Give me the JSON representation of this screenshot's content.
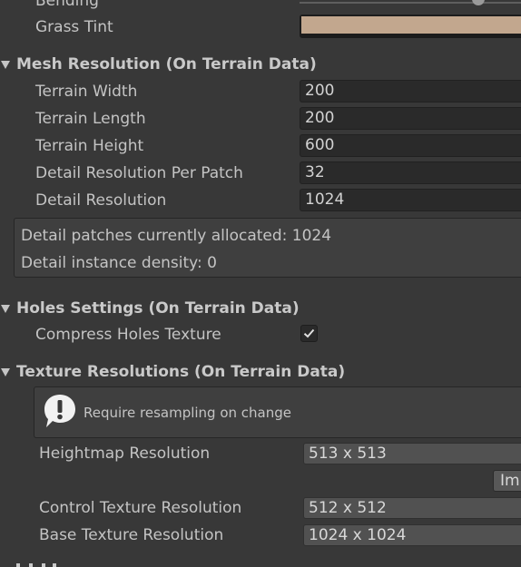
{
  "top": {
    "bending_label": "Bending",
    "grass_tint_label": "Grass Tint",
    "grass_tint_color": "#c2a78e"
  },
  "mesh": {
    "header": "Mesh Resolution (On Terrain Data)",
    "rows": [
      {
        "label": "Terrain Width",
        "value": "200"
      },
      {
        "label": "Terrain Length",
        "value": "200"
      },
      {
        "label": "Terrain Height",
        "value": "600"
      },
      {
        "label": "Detail Resolution Per Patch",
        "value": "32"
      },
      {
        "label": "Detail Resolution",
        "value": "1024"
      }
    ],
    "info_line1": "Detail patches currently allocated: 1024",
    "info_line2": "Detail instance density: 0"
  },
  "holes": {
    "header": "Holes Settings (On Terrain Data)",
    "compress_label": "Compress Holes Texture",
    "compress_checked": true
  },
  "texture": {
    "header": "Texture Resolutions (On Terrain Data)",
    "warning": "Require resampling on change",
    "heightmap_label": "Heightmap Resolution",
    "heightmap_value": "513 x 513",
    "import_button": "Imp",
    "control_label": "Control Texture Resolution",
    "control_value": "512 x 512",
    "base_label": "Base Texture Resolution",
    "base_value": "1024 x 1024"
  }
}
